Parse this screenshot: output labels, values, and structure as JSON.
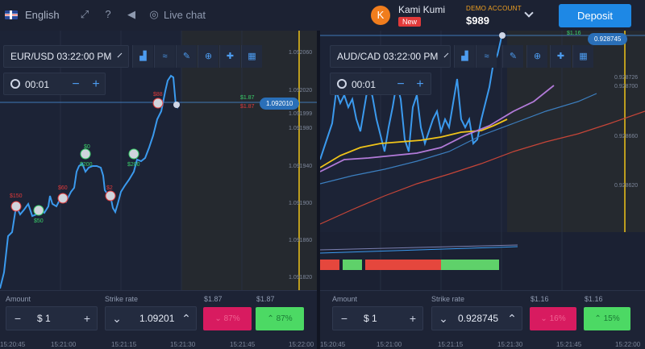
{
  "header": {
    "language": "English",
    "livechat": "Live chat",
    "user_initial": "K",
    "username": "Kami Kumi",
    "new_badge": "New",
    "account_type": "DEMO ACCOUNT",
    "balance": "$989",
    "deposit_label": "Deposit"
  },
  "left": {
    "asset": "EUR/USD 03:22:00 PM",
    "timer": "00:01",
    "current_price": "1.092010",
    "payout_up_tag": "$1.87",
    "payout_down_tag": "$1.87",
    "amount_label": "Amount",
    "amount_value": "$ 1",
    "strike_label": "Strike rate",
    "strike_value": "1.09201",
    "payout_down": "$1.87",
    "payout_up": "$1.87",
    "down_pct": "87%",
    "up_pct": "87%",
    "price_axis": [
      "1.092060",
      "1.092020",
      "1.091999",
      "1.091980",
      "1.091940",
      "1.091900",
      "1.091860",
      "1.091820"
    ],
    "time_axis": [
      "15:20:45",
      "15:21:00",
      "15:21:15",
      "15:21:30",
      "15:21:45",
      "15:22:00"
    ],
    "trades": [
      {
        "label": "$150",
        "color": "red"
      },
      {
        "label": "$50",
        "color": "green"
      },
      {
        "label": "$60",
        "color": "red"
      },
      {
        "label": "$0",
        "color": "green"
      },
      {
        "label": "$200",
        "color": "green"
      },
      {
        "label": "$2",
        "color": "red"
      },
      {
        "label": "$200",
        "color": "green"
      },
      {
        "label": "$88",
        "color": "red"
      }
    ]
  },
  "right": {
    "asset": "AUD/CAD 03:22:00 PM",
    "timer": "00:01",
    "current_price": "0.928745",
    "payout_tag": "$1.16",
    "amount_label": "Amount",
    "amount_value": "$ 1",
    "strike_label": "Strike rate",
    "strike_value": "0.928745",
    "payout_down": "$1.16",
    "payout_up": "$1.16",
    "down_pct": "16%",
    "up_pct": "15%",
    "price_axis": [
      "0.928726",
      "0.928700",
      "0.928660",
      "0.928620"
    ],
    "time_axis": [
      "15:20:45",
      "15:21:00",
      "15:21:15",
      "15:21:30",
      "15:21:45",
      "15:22:00"
    ]
  }
}
